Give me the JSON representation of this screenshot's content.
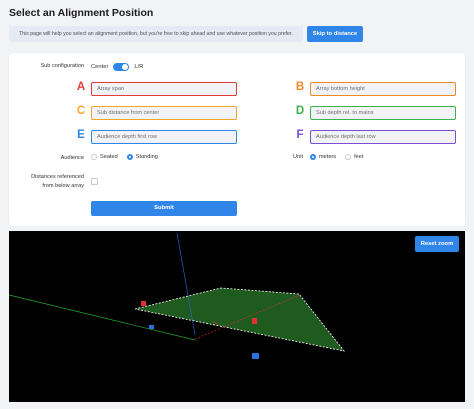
{
  "header": {
    "title": "Select an Alignment Position",
    "info_text": "This page will help you select an alignment position, but you're free to skip ahead and use whatever position you prefer.",
    "skip_label": "Skip to distance"
  },
  "form": {
    "sub_config": {
      "label": "Sub configuration",
      "option_left": "Center",
      "option_right": "L/R",
      "selected": "L/R"
    },
    "fields": [
      {
        "letter": "A",
        "placeholder": "Array span",
        "color": "#e23b3b"
      },
      {
        "letter": "B",
        "placeholder": "Array bottom height",
        "color": "#f08a24"
      },
      {
        "letter": "C",
        "placeholder": "Sub distance from center",
        "color": "#f5a623"
      },
      {
        "letter": "D",
        "placeholder": "Sub depth rel. to mains",
        "color": "#3bb54a"
      },
      {
        "letter": "E",
        "placeholder": "Audience depth first row",
        "color": "#2f86e8"
      },
      {
        "letter": "F",
        "placeholder": "Audience depth last row",
        "color": "#7b4fd6"
      }
    ],
    "audience": {
      "label": "Audience",
      "options": [
        "Seated",
        "Standing"
      ],
      "selected": "Standing"
    },
    "unit": {
      "label": "Unit",
      "options": [
        "meters",
        "feet"
      ],
      "selected": "meters"
    },
    "distances_label_line1": "Distances referenced",
    "distances_label_line2": "from below array",
    "distances_checked": false,
    "submit_label": "Submit"
  },
  "viewport": {
    "reset_label": "Reset zoom",
    "colors": {
      "background": "#000000",
      "audience_plane": "#1f5a1f",
      "x_axis": "#e03030",
      "y_axis": "#2b6fe0",
      "z_axis": "#2ea82e"
    }
  }
}
